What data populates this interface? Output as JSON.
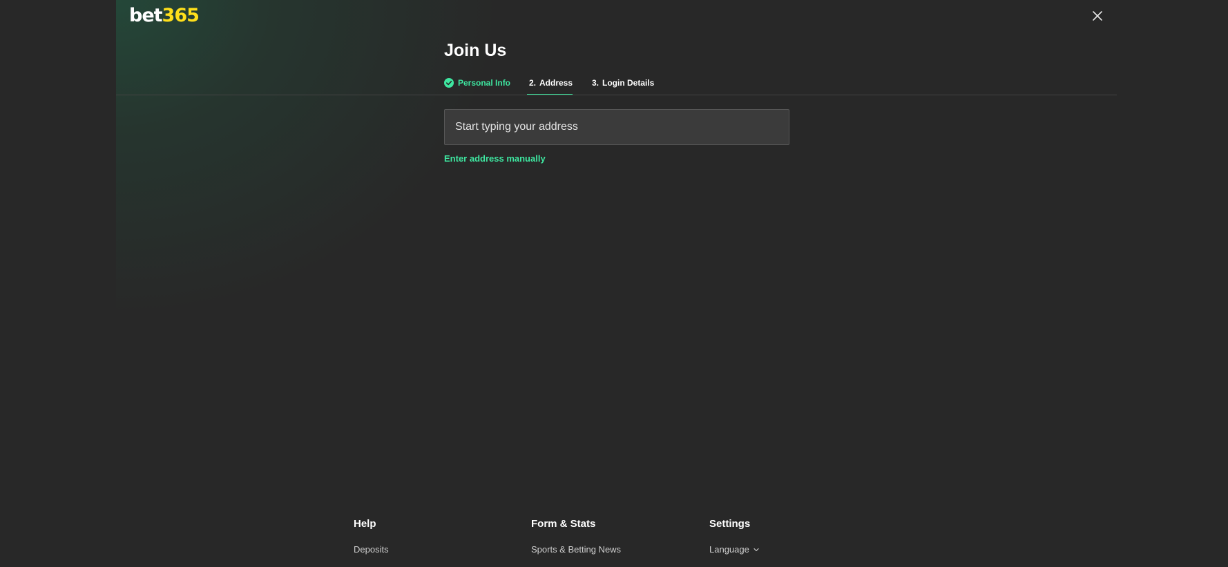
{
  "logo": {
    "part1": "bet",
    "part2": "365"
  },
  "header": {
    "close_icon": "close-icon"
  },
  "title": "Join Us",
  "steps": [
    {
      "number": "",
      "label": "Personal Info",
      "state": "complete",
      "icon": "check-circle-icon"
    },
    {
      "number": "2.",
      "label": "Address",
      "state": "active"
    },
    {
      "number": "3.",
      "label": "Login Details",
      "state": "pending"
    }
  ],
  "address": {
    "placeholder": "Start typing your address",
    "value": "",
    "manual_link": "Enter address manually"
  },
  "footer": {
    "columns": [
      {
        "heading": "Help",
        "links": [
          "Deposits"
        ]
      },
      {
        "heading": "Form & Stats",
        "links": [
          "Sports & Betting News"
        ]
      },
      {
        "heading": "Settings",
        "links": [
          "Language"
        ],
        "link_icon": "chevron-down-icon"
      }
    ]
  },
  "colors": {
    "background": "#282828",
    "accent_green": "#3ee6a0",
    "brand_yellow": "#ffdf1b",
    "input_bg": "#3b3b3b"
  }
}
